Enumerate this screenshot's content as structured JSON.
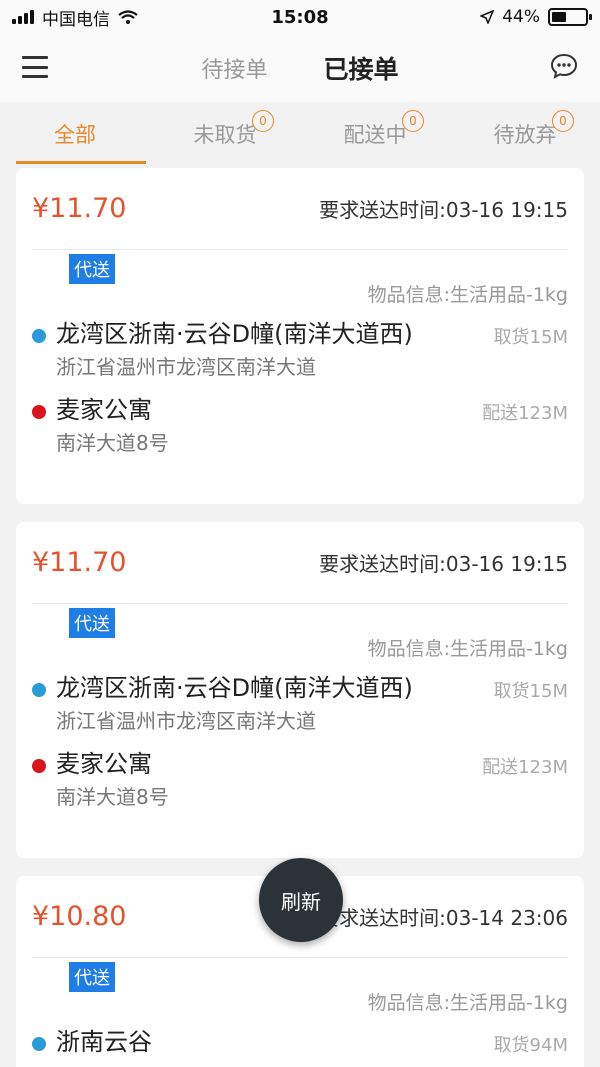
{
  "status_bar": {
    "carrier": "中国电信",
    "time": "15:08",
    "battery": "44%",
    "battery_level": 0.44
  },
  "nav": {
    "tabs": [
      "待接单",
      "已接单"
    ],
    "active_tab": "已接单"
  },
  "filters": [
    {
      "label": "全部",
      "badge": null,
      "active": true
    },
    {
      "label": "未取货",
      "badge": "0",
      "active": false
    },
    {
      "label": "配送中",
      "badge": "0",
      "active": false
    },
    {
      "label": "待放弃",
      "badge": "0",
      "active": false
    }
  ],
  "orders": [
    {
      "price": "¥11.70",
      "deadline": "要求送达时间:03-16 19:15",
      "tag": "代送",
      "goods": "物品信息:生活用品-1kg",
      "pickup": {
        "name": "龙湾区浙南·云谷D幢(南洋大道西)",
        "distance": "取货15M",
        "address": "浙江省温州市龙湾区南洋大道"
      },
      "dropoff": {
        "name": "麦家公寓",
        "distance": "配送123M",
        "address": "南洋大道8号"
      }
    },
    {
      "price": "¥11.70",
      "deadline": "要求送达时间:03-16 19:15",
      "tag": "代送",
      "goods": "物品信息:生活用品-1kg",
      "pickup": {
        "name": "龙湾区浙南·云谷D幢(南洋大道西)",
        "distance": "取货15M",
        "address": "浙江省温州市龙湾区南洋大道"
      },
      "dropoff": {
        "name": "麦家公寓",
        "distance": "配送123M",
        "address": "南洋大道8号"
      }
    },
    {
      "price": "¥10.80",
      "deadline": "要求送达时间:03-14 23:06",
      "tag": "代送",
      "goods": "物品信息:生活用品-1kg",
      "pickup": {
        "name": "浙南云谷",
        "distance": "取货94M",
        "address": ""
      }
    }
  ],
  "refresh_label": "刷新",
  "colors": {
    "accent": "#e9882b",
    "price": "#e2532e",
    "tag": "#1f7de6",
    "pickup_dot": "#2a9ad9",
    "dropoff_dot": "#d9141b"
  }
}
